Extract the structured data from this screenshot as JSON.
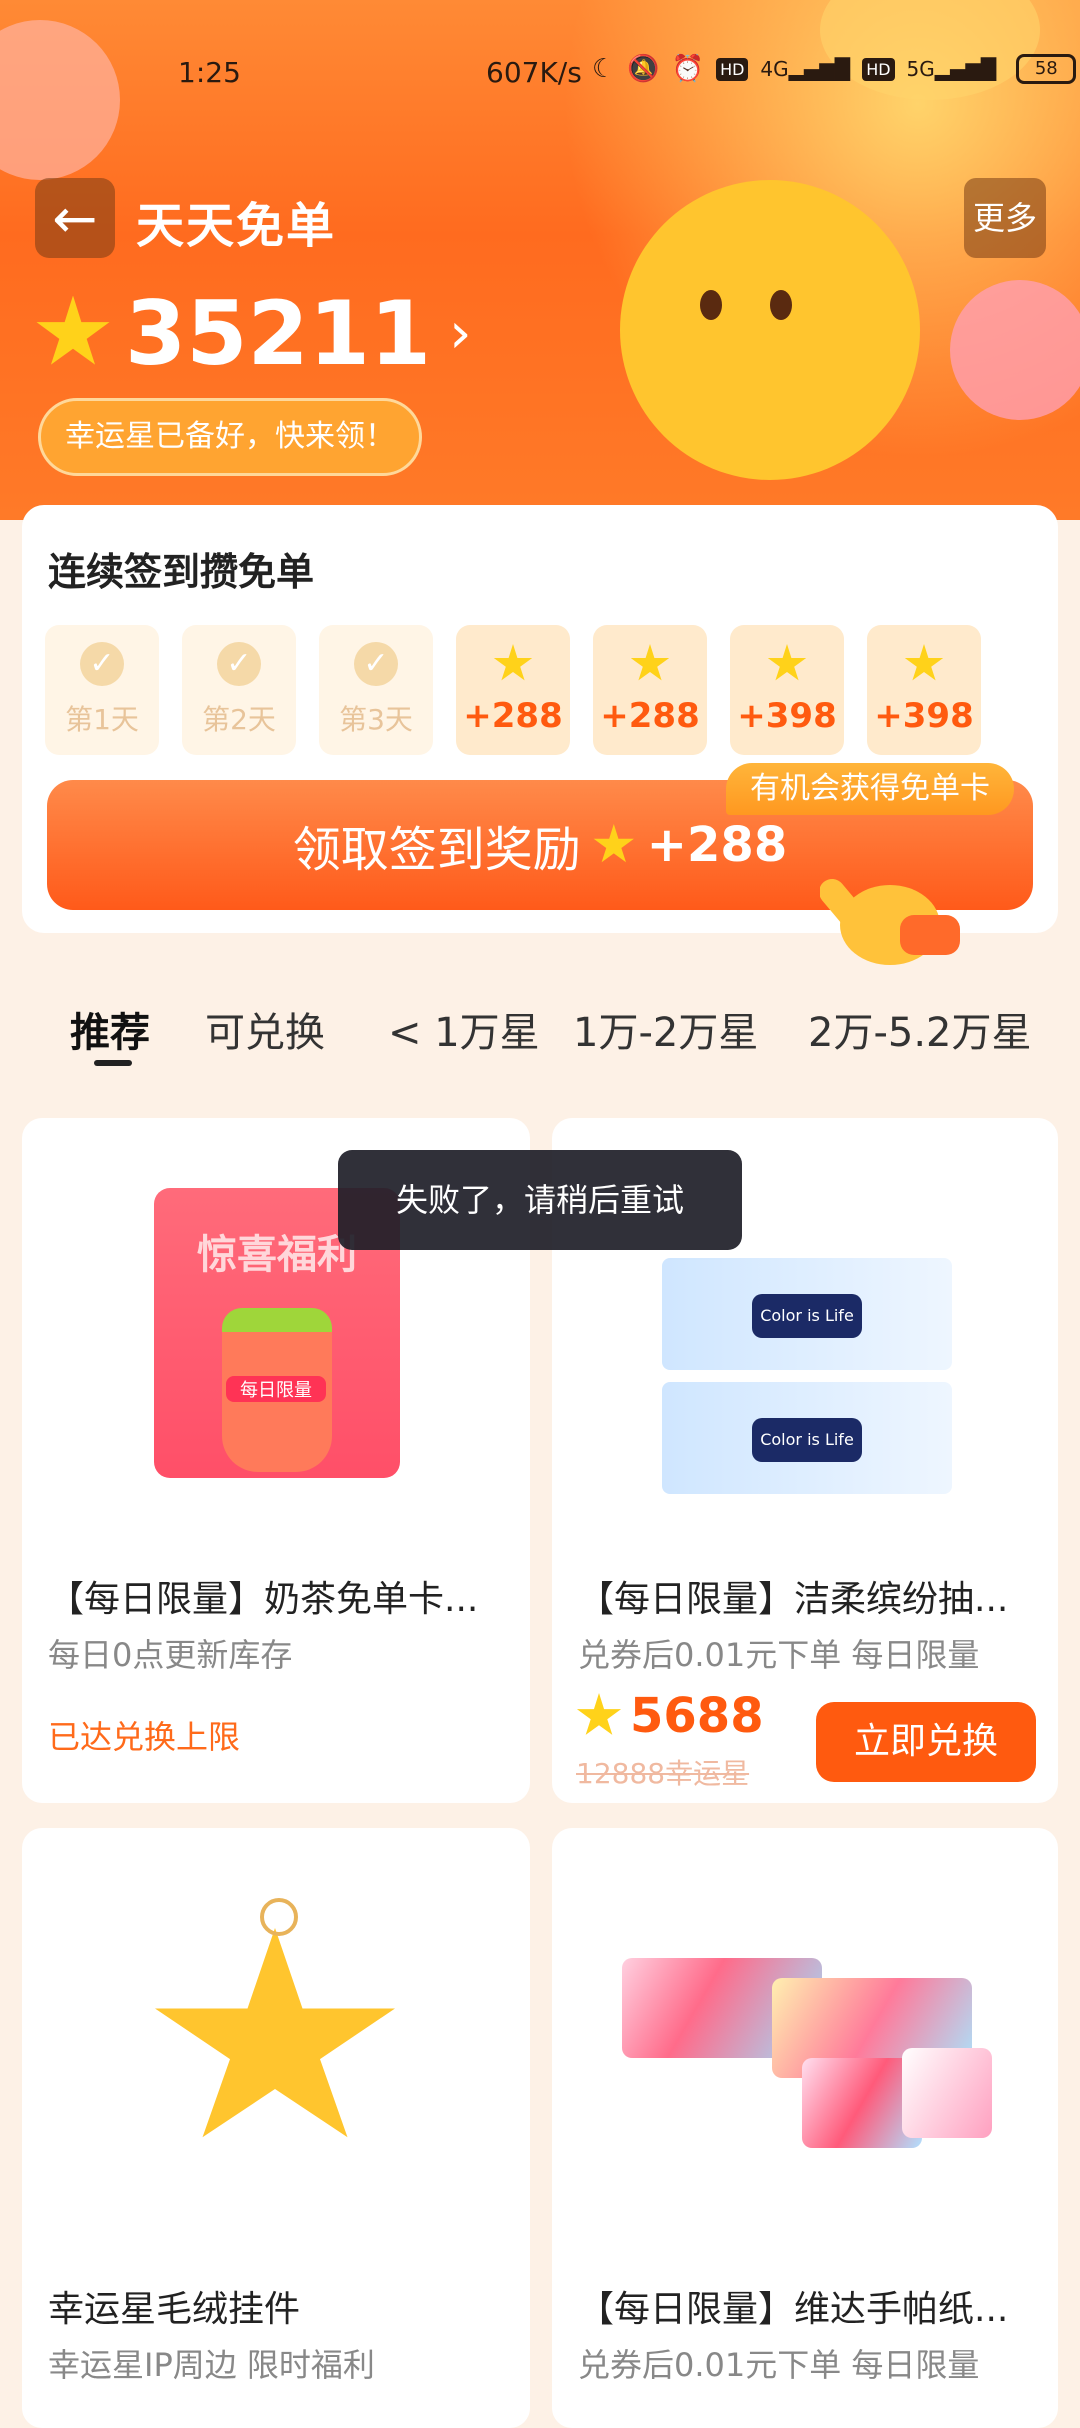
{
  "status": {
    "time": "1:25",
    "speed": "607K/s",
    "hd1": "HD",
    "net1": "4G",
    "hd2": "HD",
    "net2": "5G",
    "battery": "58"
  },
  "header": {
    "title": "天天免单",
    "more_label": "更多",
    "points": "35211",
    "hint": "幸运星已备好，快来领！"
  },
  "signin": {
    "title": "连续签到攒免单",
    "days": [
      {
        "state": "done",
        "label": "第1天"
      },
      {
        "state": "done",
        "label": "第2天"
      },
      {
        "state": "done",
        "label": "第3天"
      },
      {
        "state": "todo",
        "label": "+288"
      },
      {
        "state": "todo",
        "label": "+288"
      },
      {
        "state": "todo",
        "label": "+398"
      },
      {
        "state": "todo",
        "label": "+398"
      }
    ],
    "claim_label": "领取签到奖励",
    "claim_amount": "+288",
    "chance_tag": "有机会获得免单卡"
  },
  "tabs": [
    "推荐",
    "可兑换",
    "< 1万星",
    "1万-2万星",
    "2万-5.2万星"
  ],
  "products": [
    {
      "title": "【每日限量】奶茶免单卡...",
      "subtitle": "每日0点更新库存",
      "status": "已达兑换上限",
      "image_text": "惊喜福利",
      "badge": "每日限量"
    },
    {
      "title": "【每日限量】洁柔缤纷抽...",
      "subtitle": "兑券后0.01元下单 每日限量",
      "price": "5688",
      "original_price": "12888幸运星",
      "button": "立即兑换",
      "brand": "Color is Life"
    },
    {
      "title": "幸运星毛绒挂件",
      "subtitle": "幸运星IP周边 限时福利"
    },
    {
      "title": "【每日限量】维达手帕纸...",
      "subtitle": "兑券后0.01元下单 每日限量"
    }
  ],
  "toast": "失败了，请稍后重试"
}
